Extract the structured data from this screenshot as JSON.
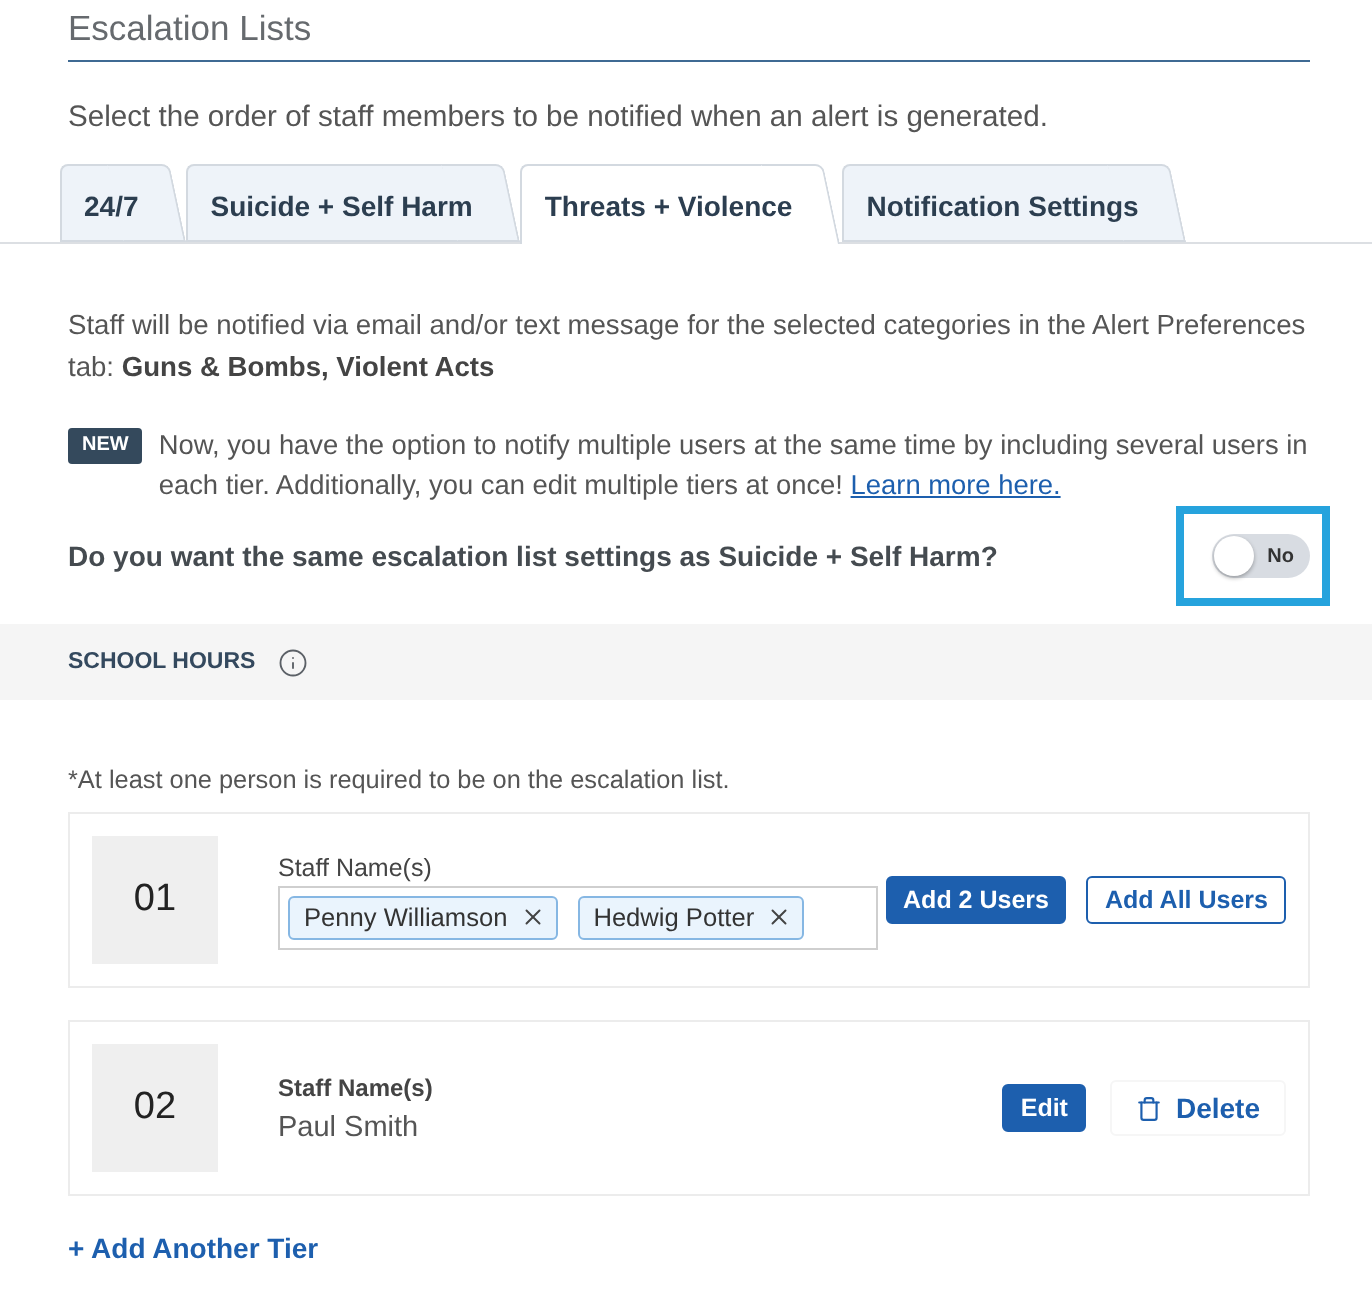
{
  "section": {
    "title": "Escalation Lists",
    "description": "Select the order of staff members to be notified when an alert is generated."
  },
  "tabs": [
    {
      "label": "24/7",
      "selected": false
    },
    {
      "label": "Suicide + Self Harm",
      "selected": false
    },
    {
      "label": "Threats + Violence",
      "selected": true
    },
    {
      "label": "Notification Settings",
      "selected": false
    }
  ],
  "info": {
    "text": "Staff will be notified via email and/or text message for the selected categories in the Alert Preferences tab: **Guns & Bombs, Violent Acts**"
  },
  "announcement": {
    "badge": "NEW",
    "text": "Now, you have the option to notify multiple users at the same time by including several users in each tier. Additionally, you can edit multiple tiers at once!",
    "link": "Learn more here."
  },
  "same_settings": {
    "question": "Do you want the same escalation list settings as Suicide + Self Harm?",
    "highlighted": true,
    "toggle": {
      "on": false,
      "label": "No"
    }
  },
  "schedule": {
    "title": "SCHOOL HOURS",
    "note": "*At least one person is required to be on the escalation list."
  },
  "tiers": [
    {
      "kind": "editing",
      "number": "01",
      "label": "Staff Name(s)",
      "chips": [
        {
          "name": "Penny Williamson"
        },
        {
          "name": "Hedwig Potter"
        }
      ],
      "actions": [
        {
          "kind": "primary",
          "label": "Add 2 Users"
        },
        {
          "kind": "outline",
          "label": "Add All Users"
        }
      ]
    },
    {
      "kind": "saved",
      "number": "02",
      "label": "Staff Name(s)",
      "staff": "Paul Smith",
      "actions": [
        {
          "kind": "primary",
          "label": "Edit"
        },
        {
          "kind": "delete",
          "label": "Delete"
        }
      ]
    }
  ],
  "add_tier": "+ Add Another Tier"
}
